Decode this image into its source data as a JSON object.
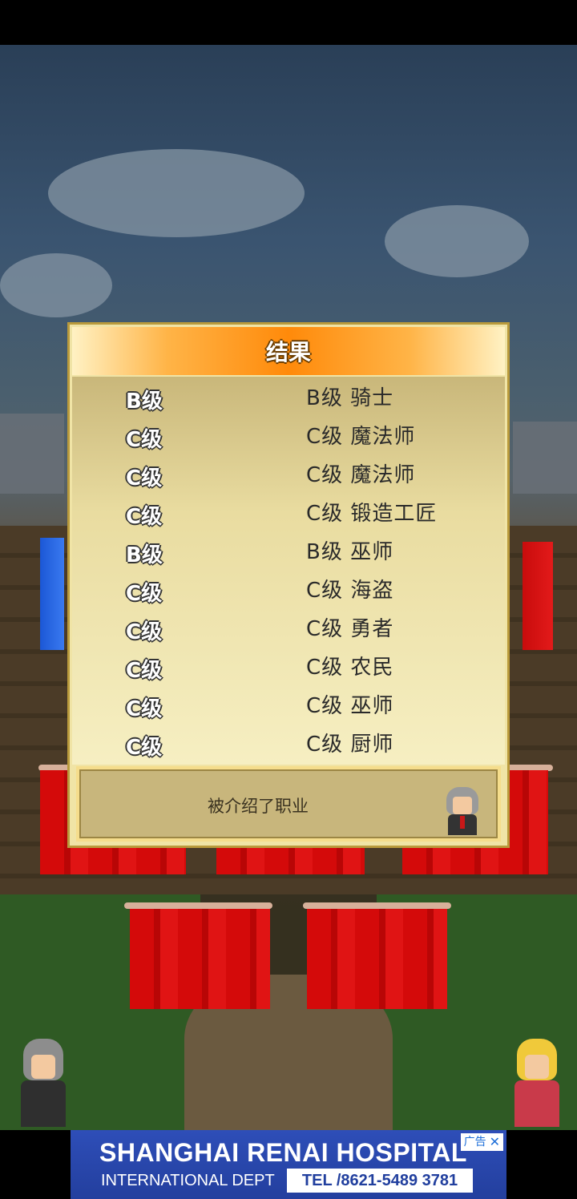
{
  "dialog": {
    "title": "结果",
    "results": [
      {
        "grade": "B级",
        "job": "B级 骑士"
      },
      {
        "grade": "C级",
        "job": "C级 魔法师"
      },
      {
        "grade": "C级",
        "job": "C级 魔法师"
      },
      {
        "grade": "C级",
        "job": "C级 锻造工匠"
      },
      {
        "grade": "B级",
        "job": "B级 巫师"
      },
      {
        "grade": "C级",
        "job": "C级 海盗"
      },
      {
        "grade": "C级",
        "job": "C级 勇者"
      },
      {
        "grade": "C级",
        "job": "C级 农民"
      },
      {
        "grade": "C级",
        "job": "C级 巫师"
      },
      {
        "grade": "C级",
        "job": "C级 厨师"
      }
    ],
    "message": "被介绍了职业"
  },
  "ad": {
    "title": "SHANGHAI RENAI HOSPITAL",
    "subtitle": "INTERNATIONAL DEPT",
    "tel": "TEL /8621-5489 3781",
    "badge": "广告",
    "close": "✕"
  },
  "colors": {
    "header_orange": "#ff8a0a",
    "panel": "#f0e4a6",
    "curtain_red": "#d40a0a",
    "ad_blue": "#233f9e"
  }
}
